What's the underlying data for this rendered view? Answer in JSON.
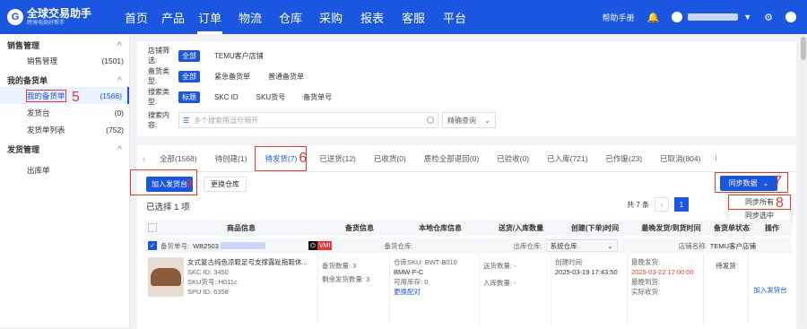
{
  "app": {
    "logo_title": "全球交易助手",
    "logo_sub": "跨境电商好帮手",
    "help": "帮助手册"
  },
  "nav": [
    "首页",
    "产品",
    "订单",
    "物流",
    "仓库",
    "采购",
    "报表",
    "客服",
    "平台"
  ],
  "sidebar": [
    {
      "title": "销售管理",
      "items": [
        {
          "label": "销售管理",
          "count": "(1501)"
        }
      ]
    },
    {
      "title": "我的备货单",
      "items": [
        {
          "label": "我的备货单",
          "count": "(1568)"
        },
        {
          "label": "发货台",
          "count": "(0)"
        },
        {
          "label": "发货单列表",
          "count": "(752)"
        }
      ]
    },
    {
      "title": "发货管理",
      "items": [
        {
          "label": "出库单",
          "count": ""
        }
      ]
    }
  ],
  "filters": {
    "shop_label": "店铺筛选:",
    "shop_opts": [
      "全部",
      "TEMU客户店铺"
    ],
    "type_label": "备货类型:",
    "type_opts": [
      "全部",
      "紧急备货单",
      "普通备货单"
    ],
    "search_type_label": "搜索类型:",
    "search_type_opts": [
      "标题",
      "SKC ID",
      "SKU货号",
      "备货单号"
    ],
    "content_label": "搜索内容:",
    "search_placeholder": "多个搜索用逗号隔开",
    "precise": "精确查询"
  },
  "tabs": [
    "全部(1568)",
    "待创建(1)",
    "待发货(7)",
    "已送货(12)",
    "已收货(0)",
    "质检全部退回(0)",
    "已验收(0)",
    "已入库(721)",
    "已作废(23)",
    "已取消(804)"
  ],
  "actions": {
    "add_to_shipping": "加入发货台",
    "change_warehouse": "更换仓库",
    "sync_data": "同步数据",
    "sync_all": "同步所有",
    "sync_selected": "同步选中"
  },
  "selected": "已选择 1 项",
  "pager": {
    "total": "共 7 条",
    "page": "1"
  },
  "table": {
    "headers": [
      "商品信息",
      "备货信息",
      "本地仓库信息",
      "送货/入库数量",
      "创建(下单)时间",
      "最晚发货/到货时间",
      "备货单状态",
      "操作"
    ],
    "order_no_label": "备货单号:",
    "order_no": "WB2503",
    "warehouse_label": "备货仓库:",
    "ship_warehouse_label": "出库仓库:",
    "ship_warehouse": "系统仓库",
    "shop_name_label": "店铺名称:",
    "shop_name": "TEMU客户店铺",
    "product_title": "女式复古纯色凉鞋足弓支撑露趾拖鞋休...",
    "skc": "SKC ID: 3450",
    "sku": "SKU货号: H011c",
    "spu": "SPU ID: 6358",
    "stock_qty": "备货数量: 3",
    "remain_qty": "剩余发货数量: 3",
    "wh_sku": "仓库SKU: BWT-B010",
    "wh_sku2": "BMW-F-C",
    "avail": "可用库存: 0",
    "change_pair": "更换配对",
    "ship_qty": "送货数量: -",
    "in_qty": "入库数量: -",
    "created_label": "创建时间:",
    "created": "2025-03-19 17:43:50",
    "latest_ship_label": "最晚发货:",
    "latest_ship": "2025-03-22 17:00:00",
    "latest_arrive": "最晚到货:",
    "actual_arrive": "实际收货:",
    "status": "待发货",
    "op": "加入发货台"
  },
  "annotations": [
    "5",
    "6",
    "7",
    "8",
    "9"
  ]
}
